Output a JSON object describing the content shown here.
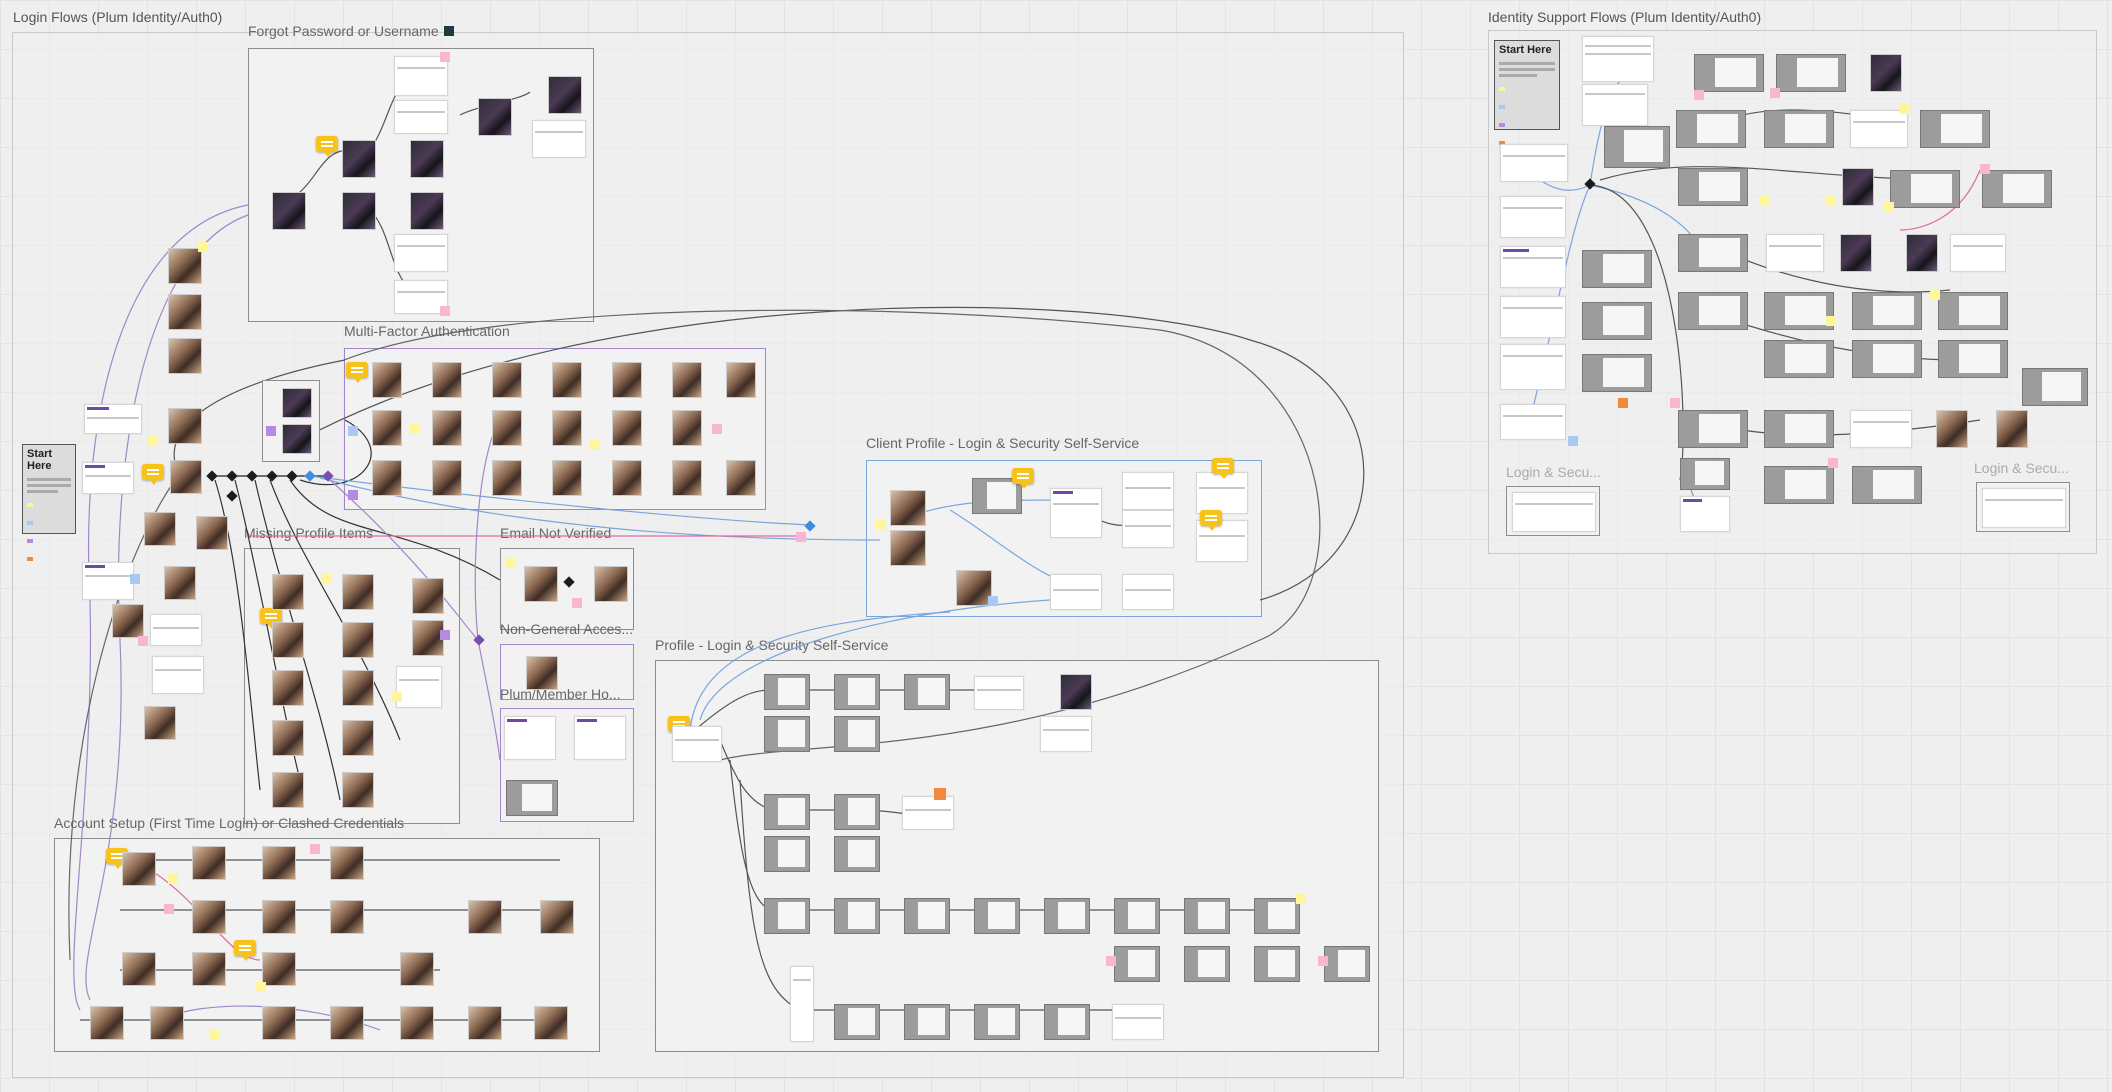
{
  "boards": {
    "login_flows": {
      "title": "Login Flows (Plum Identity/Auth0)"
    },
    "identity_support": {
      "title": "Identity Support Flows (Plum Identity/Auth0)"
    }
  },
  "frames": {
    "forgot": {
      "title": "Forgot Password or Username"
    },
    "mfa": {
      "title": "Multi-Factor Authentication"
    },
    "client_profile": {
      "title": "Client Profile - Login & Security Self-Service"
    },
    "missing_profile": {
      "title": "Missing Profile Items"
    },
    "email_not_verified": {
      "title": "Email Not Verified"
    },
    "non_general": {
      "title": "Non-General Acces..."
    },
    "plum_member": {
      "title": "Plum/Member Ho..."
    },
    "profile_login": {
      "title": "Profile - Login & Security Self-Service"
    },
    "account_setup": {
      "title": "Account Setup (First Time Login) or Clashed Credentials"
    },
    "login_sec_a": {
      "title": "Login & Secu..."
    },
    "login_sec_b": {
      "title": "Login & Secu..."
    }
  },
  "start_boxes": {
    "left": {
      "title": "Start Here"
    },
    "right": {
      "title": "Start Here"
    }
  },
  "colors": {
    "canvas": "#efefef",
    "frame_border": "#8d8d8d",
    "purple_link": "#a187c9",
    "blue_link": "#7aa6dc",
    "pink_link": "#e06a9a",
    "comment": "#f7c21a",
    "sticky_yellow": "#fff59a",
    "sticky_pink": "#f7b6d2"
  },
  "icons": [
    "comment-icon",
    "decision-diamond-icon"
  ]
}
